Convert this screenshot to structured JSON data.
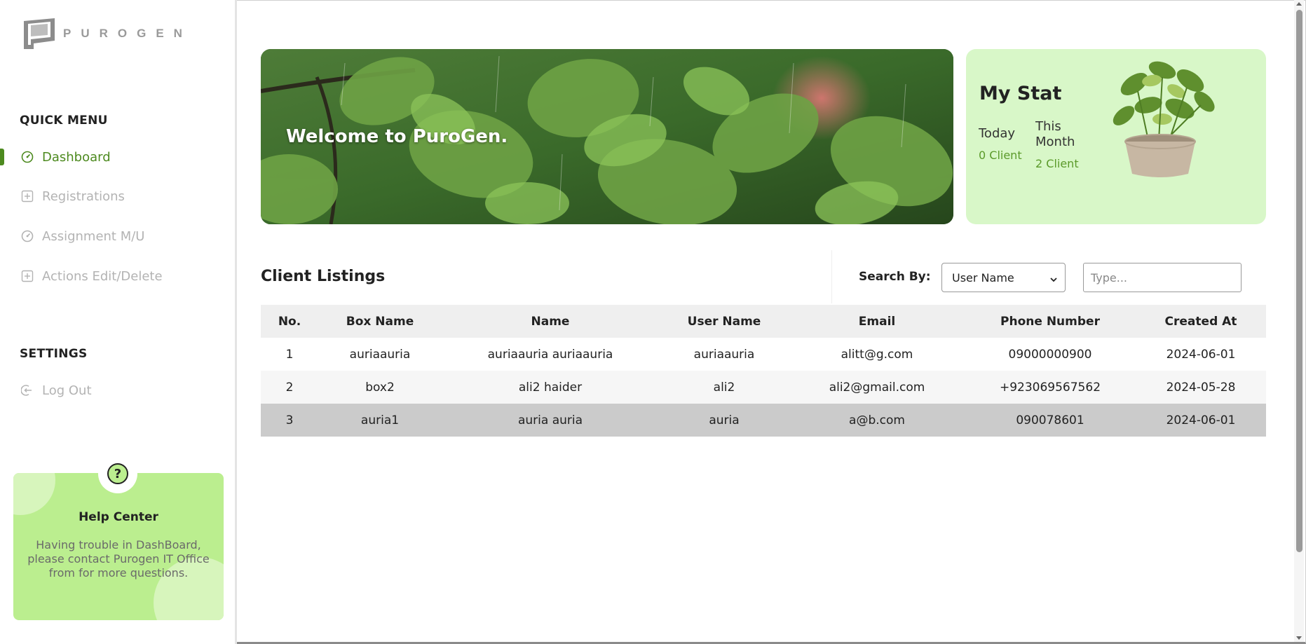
{
  "brand": {
    "logo_text": "PUROGEN"
  },
  "sidebar": {
    "quick_menu_title": "QUICK MENU",
    "items": [
      {
        "label": "Dashboard",
        "icon": "dashboard-icon",
        "active": true
      },
      {
        "label": "Registrations",
        "icon": "plus-square-icon",
        "active": false
      },
      {
        "label": "Assignment M/U",
        "icon": "dashboard-icon",
        "active": false
      },
      {
        "label": "Actions Edit/Delete",
        "icon": "plus-square-icon",
        "active": false
      }
    ],
    "settings_title": "SETTINGS",
    "logout_label": "Log Out"
  },
  "help": {
    "title": "Help Center",
    "text": "Having trouble in DashBoard, please contact Purogen IT Office from for more questions."
  },
  "banner": {
    "title": "Welcome to PuroGen."
  },
  "stats": {
    "title": "My Stat",
    "today_label": "Today",
    "today_value": "0 Client",
    "month_label": "This Month",
    "month_value": "2 Client"
  },
  "listing": {
    "title": "Client Listings",
    "search_label": "Search By:",
    "search_select_value": "User Name",
    "search_placeholder": "Type..."
  },
  "table": {
    "headers": [
      "No.",
      "Box Name",
      "Name",
      "User Name",
      "Email",
      "Phone Number",
      "Created At"
    ],
    "rows": [
      [
        "1",
        "auriaauria",
        "auriaauria auriaauria",
        "auriaauria",
        "alitt@g.com",
        "09000000900",
        "2024-06-01"
      ],
      [
        "2",
        "box2",
        "ali2 haider",
        "ali2",
        "ali2@gmail.com",
        "+923069567562",
        "2024-05-28"
      ],
      [
        "3",
        "auria1",
        "auria auria",
        "auria",
        "a@b.com",
        "090078601",
        "2024-06-01"
      ]
    ]
  },
  "colors": {
    "accent": "#4d8a1f",
    "help_card": "#bbee8f",
    "stat_card": "#d8f7c8",
    "highlight_row": "#cbcbcb"
  }
}
